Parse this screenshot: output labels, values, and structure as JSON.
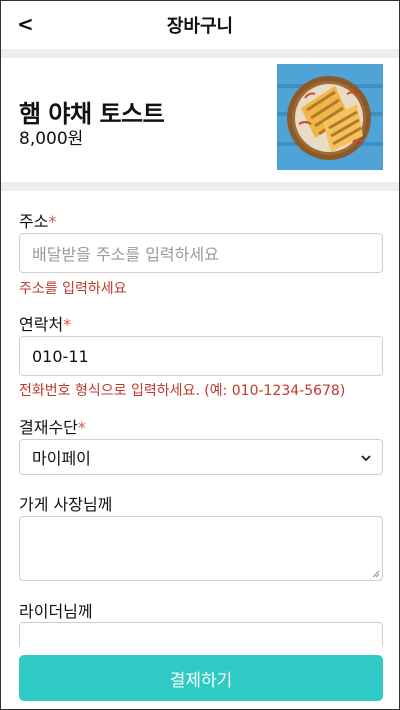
{
  "header": {
    "back_label": "<",
    "title": "장바구니"
  },
  "product": {
    "name": "햄 야채 토스트",
    "price": "8,000원",
    "image_name": "toast-photo"
  },
  "form": {
    "address": {
      "label": "주소",
      "required_mark": "*",
      "placeholder": "배달받을 주소를 입력하세요",
      "error": "주소를 입력하세요"
    },
    "contact": {
      "label": "연락처",
      "required_mark": "*",
      "value": "010-11",
      "error": "전화번호 형식으로 입력하세요. (예: 010-1234-5678)"
    },
    "payment": {
      "label": "결재수단",
      "required_mark": "*",
      "selected": "마이페이"
    },
    "to_owner": {
      "label": "가게 사장님께",
      "value": ""
    },
    "to_rider": {
      "label": "라이더님께",
      "value": ""
    }
  },
  "pay_button": {
    "label": "결제하기"
  },
  "colors": {
    "accent": "#2fcac6",
    "error": "#c0392b",
    "required": "#d9534f",
    "divider": "#eeeeee",
    "border": "#cfcfcf",
    "placeholder": "#9a9a9a"
  }
}
